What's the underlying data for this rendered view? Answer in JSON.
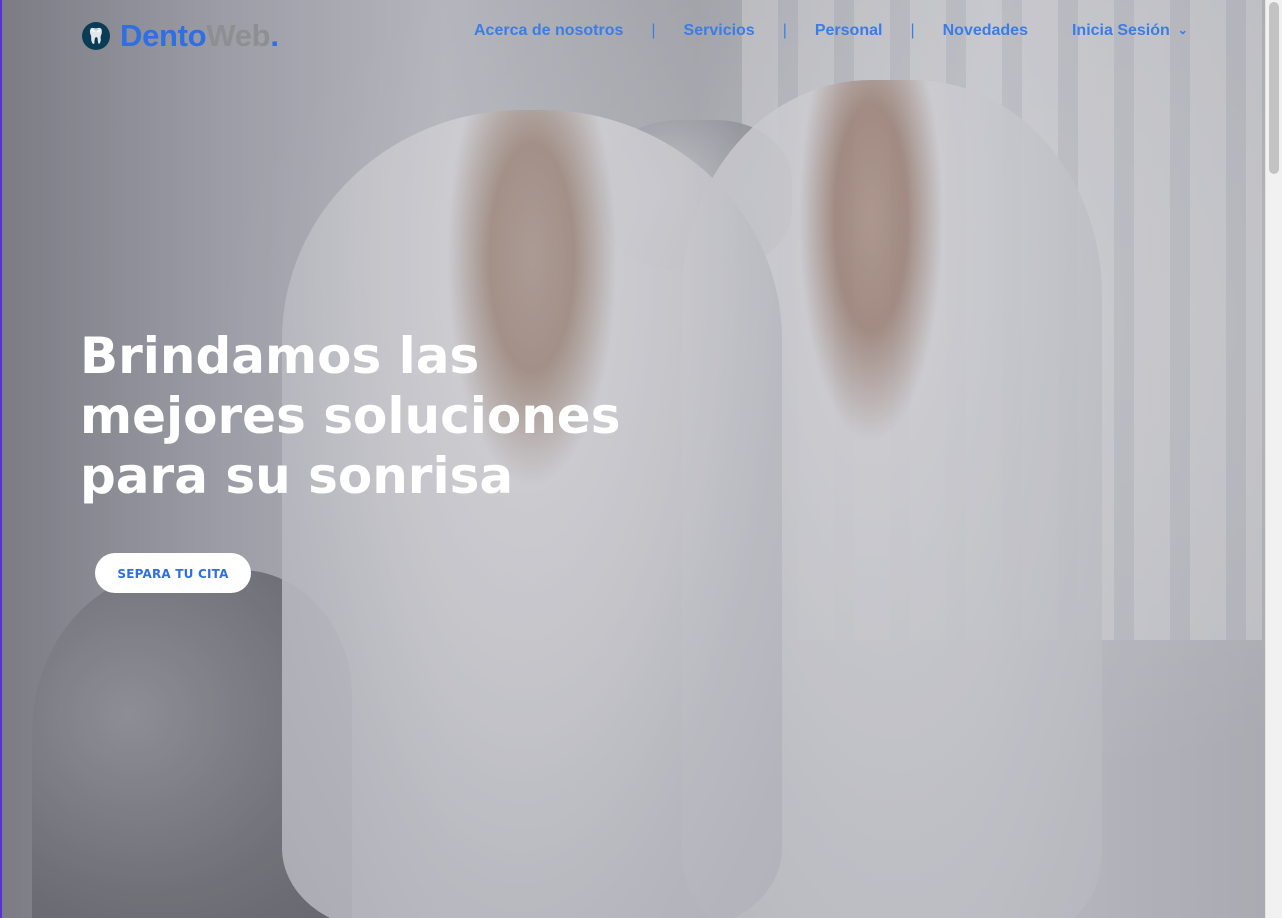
{
  "brand": {
    "name_part1": "Dento",
    "name_part2": "Web",
    "dot": ".",
    "logo_icon": "tooth-icon"
  },
  "nav": {
    "items": [
      {
        "label": "Acerca de nosotros"
      },
      {
        "label": "Servicios"
      },
      {
        "label": "Personal"
      },
      {
        "label": "Novedades"
      },
      {
        "label": "Inicia Sesión",
        "icon": "chevron-down-icon"
      }
    ],
    "separator": "|"
  },
  "hero": {
    "title_line1": "Brindamos las",
    "title_line2": "mejores soluciones",
    "title_line3": "para su sonrisa",
    "cta_label": "SEPARA TU CITA"
  },
  "colors": {
    "accent": "#2f6fe3",
    "nav_link": "#3a7de6",
    "logo_secondary": "#8f8f93",
    "cta_bg": "#ffffff",
    "hero_text": "#ffffff"
  }
}
